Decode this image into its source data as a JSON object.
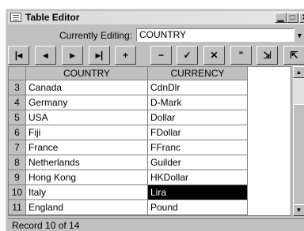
{
  "window": {
    "title": "Table Editor",
    "minimize": "▁",
    "maximize": "□",
    "close": "✕"
  },
  "editing": {
    "label": "Currently Editing:",
    "value": "COUNTRY"
  },
  "navbar": {
    "buttons": [
      {
        "icon": "first-record-icon",
        "glyph": "|◂"
      },
      {
        "icon": "prior-record-icon",
        "glyph": "◂"
      },
      {
        "icon": "next-record-icon",
        "glyph": "▸"
      },
      {
        "icon": "last-record-icon",
        "glyph": "▸|"
      },
      {
        "icon": "insert-icon",
        "glyph": "+"
      },
      {
        "icon": "delete-icon",
        "glyph": "−"
      },
      {
        "icon": "post-icon",
        "glyph": "✓"
      },
      {
        "icon": "cancel-icon",
        "glyph": "✕"
      },
      {
        "icon": "refresh-icon",
        "glyph": "\""
      },
      {
        "icon": "export-icon",
        "glyph": "⇲"
      },
      {
        "icon": "import-icon",
        "glyph": "⇱"
      }
    ]
  },
  "grid": {
    "columns": [
      "COUNTRY",
      "CURRENCY"
    ],
    "rows": [
      {
        "num": "3",
        "country": "Canada",
        "currency": "CdnDlr"
      },
      {
        "num": "4",
        "country": "Germany",
        "currency": "D-Mark"
      },
      {
        "num": "5",
        "country": "USA",
        "currency": "Dollar"
      },
      {
        "num": "6",
        "country": "Fiji",
        "currency": "FDollar"
      },
      {
        "num": "7",
        "country": "France",
        "currency": "FFranc"
      },
      {
        "num": "8",
        "country": "Netherlands",
        "currency": "Guilder"
      },
      {
        "num": "9",
        "country": "Hong Kong",
        "currency": "HKDollar"
      },
      {
        "num": "10",
        "country": "Italy",
        "currency": "Lira"
      },
      {
        "num": "11",
        "country": "England",
        "currency": "Pound"
      }
    ],
    "selected_row": "10"
  },
  "status": "Record 10 of 14"
}
